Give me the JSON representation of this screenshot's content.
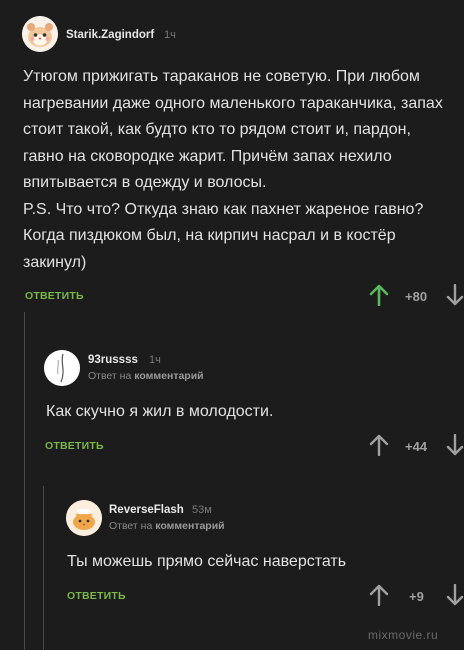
{
  "comments": [
    {
      "author": "Starik.Zagindorf",
      "time": "1ч",
      "body": "Утюгом прижигать тараканов не советую. При любом нагревании даже одного маленького тараканчика, запах стоит такой, как будто кто то рядом стоит и, пардон, гавно на сковородке жарит. Причём запах нехило впитывается в одежду и волосы.\nP.S. Что что? Откуда знаю как пахнет жареное гавно? Когда пиздюком был, на кирпич насрал и в костёр закинул)",
      "reply_label": "ОТВЕТИТЬ",
      "rating": "+80",
      "upvote_color": "#5cb85c"
    },
    {
      "author": "93russss",
      "time": "1ч",
      "reply_to_prefix": "Ответ на",
      "reply_to_link": "комментарий",
      "body": "Как скучно я жил в молодости.",
      "reply_label": "ОТВЕТИТЬ",
      "rating": "+44"
    },
    {
      "author": "ReverseFlash",
      "time": "53м",
      "reply_to_prefix": "Ответ на",
      "reply_to_link": "комментарий",
      "body": "Ты можешь прямо сейчас наверстать",
      "reply_label": "ОТВЕТИТЬ",
      "rating": "+9"
    }
  ],
  "watermark": "mixmovie.ru",
  "colors": {
    "background": "#1c1c1d",
    "reply_green": "#7ab84a",
    "rating_gray": "#a0a0a0"
  }
}
